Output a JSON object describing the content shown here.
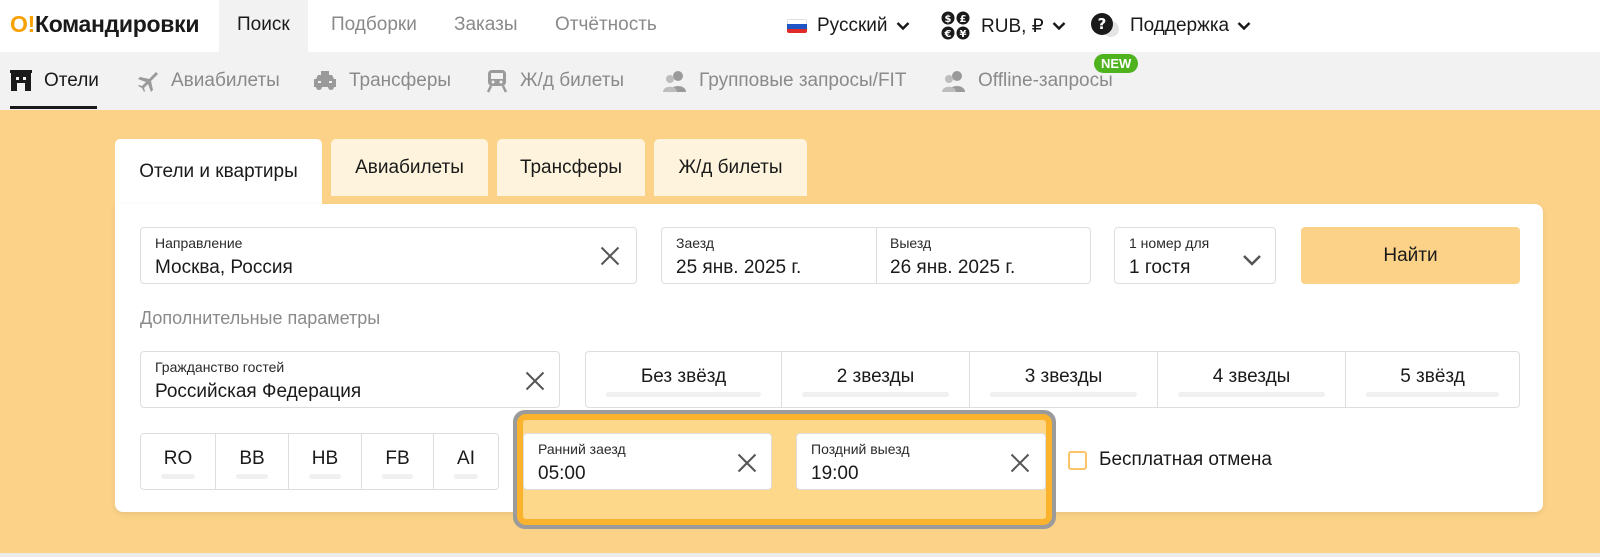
{
  "header": {
    "logo_o": "О!",
    "logo_text": "Командировки",
    "nav": [
      "Поиск",
      "Подборки",
      "Заказы",
      "Отчётность"
    ],
    "language": "Русский",
    "currency": "RUB, ₽",
    "support": "Поддержка"
  },
  "products": {
    "items": [
      "Отели",
      "Авиабилеты",
      "Трансферы",
      "Ж/д билеты",
      "Групповые запросы/FIT",
      "Offline-запросы"
    ],
    "new_badge": "NEW"
  },
  "search_tabs": [
    "Отели и квартиры",
    "Авиабилеты",
    "Трансферы",
    "Ж/д билеты"
  ],
  "form": {
    "direction_label": "Направление",
    "direction_value": "Москва, Россия",
    "checkin_label": "Заезд",
    "checkin_value": "25 янв. 2025 г.",
    "checkout_label": "Выезд",
    "checkout_value": "26 янв. 2025 г.",
    "guests_label": "1 номер для",
    "guests_value": "1 гостя",
    "find_button": "Найти",
    "extra_params": "Дополнительные параметры",
    "citizenship_label": "Гражданство гостей",
    "citizenship_value": "Российская Федерация",
    "stars": [
      "Без звёзд",
      "2 звезды",
      "3 звезды",
      "4 звезды",
      "5 звёзд"
    ],
    "meals": [
      "RO",
      "BB",
      "HB",
      "FB",
      "AI"
    ],
    "early_checkin_label": "Ранний заезд",
    "early_checkin_value": "05:00",
    "late_checkout_label": "Поздний выезд",
    "late_checkout_value": "19:00",
    "free_cancel_label": "Бесплатная отмена",
    "free_cancel_checked": false
  },
  "colors": {
    "accent": "#fbd287",
    "highlight": "#fbb32e",
    "logo_o": "#f7a100",
    "new_badge": "#4eb31d"
  }
}
